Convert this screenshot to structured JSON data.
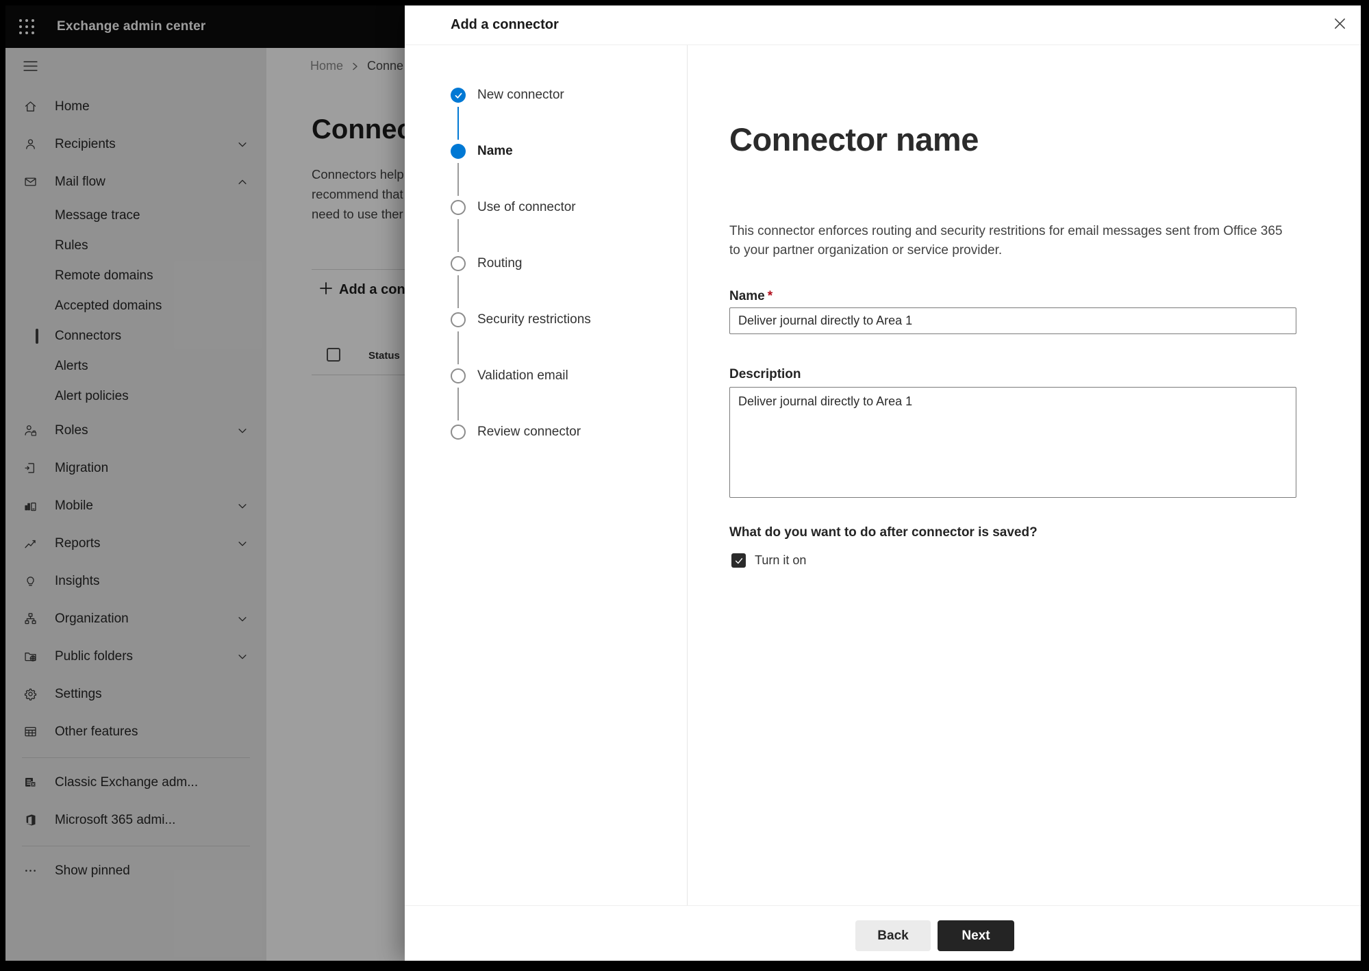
{
  "topbar": {
    "title": "Exchange admin center"
  },
  "sidebar": {
    "items": [
      {
        "label": "Home",
        "icon": "home-icon"
      },
      {
        "label": "Recipients",
        "icon": "person-icon",
        "chevron": "down"
      },
      {
        "label": "Mail flow",
        "icon": "mail-icon",
        "chevron": "up",
        "expanded": true
      },
      {
        "label": "Message trace",
        "sub": true
      },
      {
        "label": "Rules",
        "sub": true
      },
      {
        "label": "Remote domains",
        "sub": true
      },
      {
        "label": "Accepted domains",
        "sub": true
      },
      {
        "label": "Connectors",
        "sub": true,
        "selected": true
      },
      {
        "label": "Alerts",
        "sub": true
      },
      {
        "label": "Alert policies",
        "sub": true
      },
      {
        "label": "Roles",
        "icon": "roles-icon",
        "chevron": "down"
      },
      {
        "label": "Migration",
        "icon": "migration-icon"
      },
      {
        "label": "Mobile",
        "icon": "mobile-icon",
        "chevron": "down"
      },
      {
        "label": "Reports",
        "icon": "reports-icon",
        "chevron": "down"
      },
      {
        "label": "Insights",
        "icon": "lightbulb-icon"
      },
      {
        "label": "Organization",
        "icon": "org-chart-icon",
        "chevron": "down"
      },
      {
        "label": "Public folders",
        "icon": "folder-globe-icon",
        "chevron": "down"
      },
      {
        "label": "Settings",
        "icon": "gear-icon"
      },
      {
        "label": "Other features",
        "icon": "table-icon"
      },
      {
        "label": "Classic Exchange adm...",
        "icon": "exchange-logo-icon"
      },
      {
        "label": "Microsoft 365 admi...",
        "icon": "office-logo-icon"
      },
      {
        "label": "Show pinned",
        "icon": "ellipsis-icon"
      }
    ]
  },
  "page": {
    "breadcrumb": {
      "home": "Home",
      "current": "Conne"
    },
    "title": "Connec",
    "description_lines": [
      "Connectors help",
      "recommend that",
      "need to use ther"
    ],
    "add_button_label": "Add a conn",
    "list_header": "Status"
  },
  "dialog": {
    "title": "Add a connector",
    "steps": [
      {
        "label": "New connector",
        "state": "completed"
      },
      {
        "label": "Name",
        "state": "current"
      },
      {
        "label": "Use of connector",
        "state": "upcoming"
      },
      {
        "label": "Routing",
        "state": "upcoming"
      },
      {
        "label": "Security restrictions",
        "state": "upcoming"
      },
      {
        "label": "Validation email",
        "state": "upcoming"
      },
      {
        "label": "Review connector",
        "state": "upcoming"
      }
    ],
    "content": {
      "heading": "Connector name",
      "description_line1": "This connector enforces routing and security restritions for email messages sent from Office 365",
      "description_line2": "to your partner organization or service provider.",
      "name_label": "Name",
      "required_mark": "*",
      "name_value": "Deliver journal directly to Area 1",
      "description_label": "Description",
      "description_value": "Deliver journal directly to Area 1",
      "after_save_question": "What do you want to do after connector is saved?",
      "turn_on_label": "Turn it on",
      "turn_on_checked": true
    },
    "footer": {
      "back_label": "Back",
      "next_label": "Next"
    },
    "colors": {
      "accent": "#0078d4",
      "next_button": "#242424"
    }
  }
}
